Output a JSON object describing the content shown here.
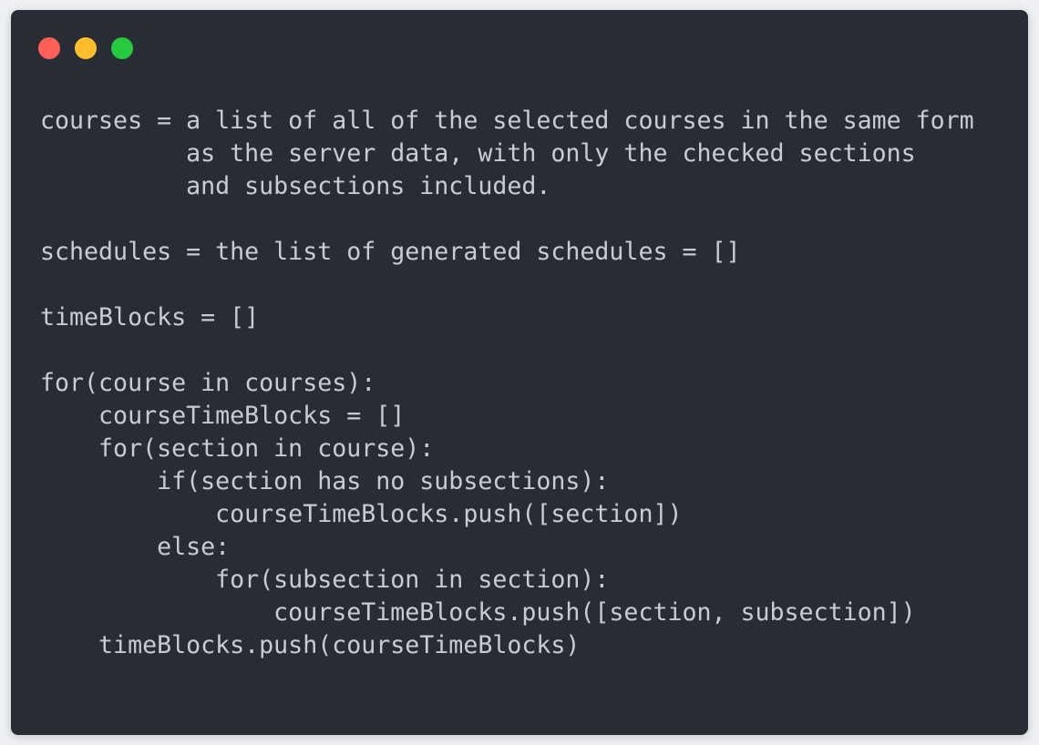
{
  "window": {
    "controls": [
      {
        "name": "close-button",
        "color": "#ff5f56"
      },
      {
        "name": "minimize-button",
        "color": "#ffbd2e"
      },
      {
        "name": "maximize-button",
        "color": "#27c93f"
      }
    ],
    "background": "#282c34",
    "text_color": "#c8ccd4"
  },
  "code": {
    "lines": [
      "courses = a list of all of the selected courses in the same form",
      "          as the server data, with only the checked sections",
      "          and subsections included.",
      "",
      "schedules = the list of generated schedules = []",
      "",
      "timeBlocks = []",
      "",
      "for(course in courses):",
      "    courseTimeBlocks = []",
      "    for(section in course):",
      "        if(section has no subsections):",
      "            courseTimeBlocks.push([section])",
      "        else:",
      "            for(subsection in section):",
      "                courseTimeBlocks.push([section, subsection])",
      "    timeBlocks.push(courseTimeBlocks)"
    ]
  }
}
